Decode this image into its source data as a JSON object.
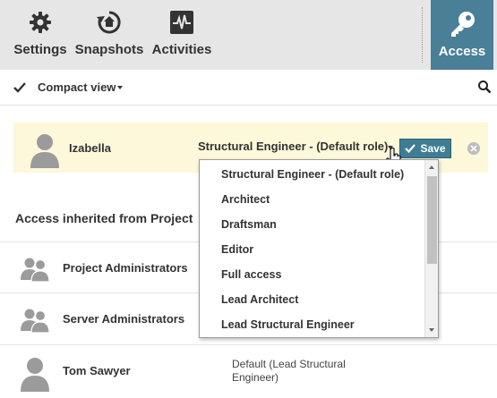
{
  "toolbar": {
    "settings_label": "Settings",
    "snapshots_label": "Snapshots",
    "activities_label": "Activities",
    "access_label": "Access",
    "active_tab": "Access",
    "accent_color": "#4a7f98"
  },
  "viewbar": {
    "view_label": "Compact view"
  },
  "selected_user": {
    "name": "Izabella",
    "role": "Structural Engineer - (Default role)",
    "save_label": "Save",
    "highlight_color": "#fcf8d9"
  },
  "role_dropdown": {
    "options": [
      "Structural Engineer - (Default role)",
      "Architect",
      "Draftsman",
      "Editor",
      "Full access",
      "Lead Architect",
      "Lead Structural Engineer"
    ]
  },
  "inherited": {
    "title": "Access inherited from Project",
    "rows": [
      {
        "name": "Project Administrators",
        "icon": "group-icon"
      },
      {
        "name": "Server Administrators",
        "icon": "group-icon"
      },
      {
        "name": "Tom Sawyer",
        "icon": "user-icon",
        "role": "Default  (Lead Structural Engineer)"
      }
    ]
  }
}
